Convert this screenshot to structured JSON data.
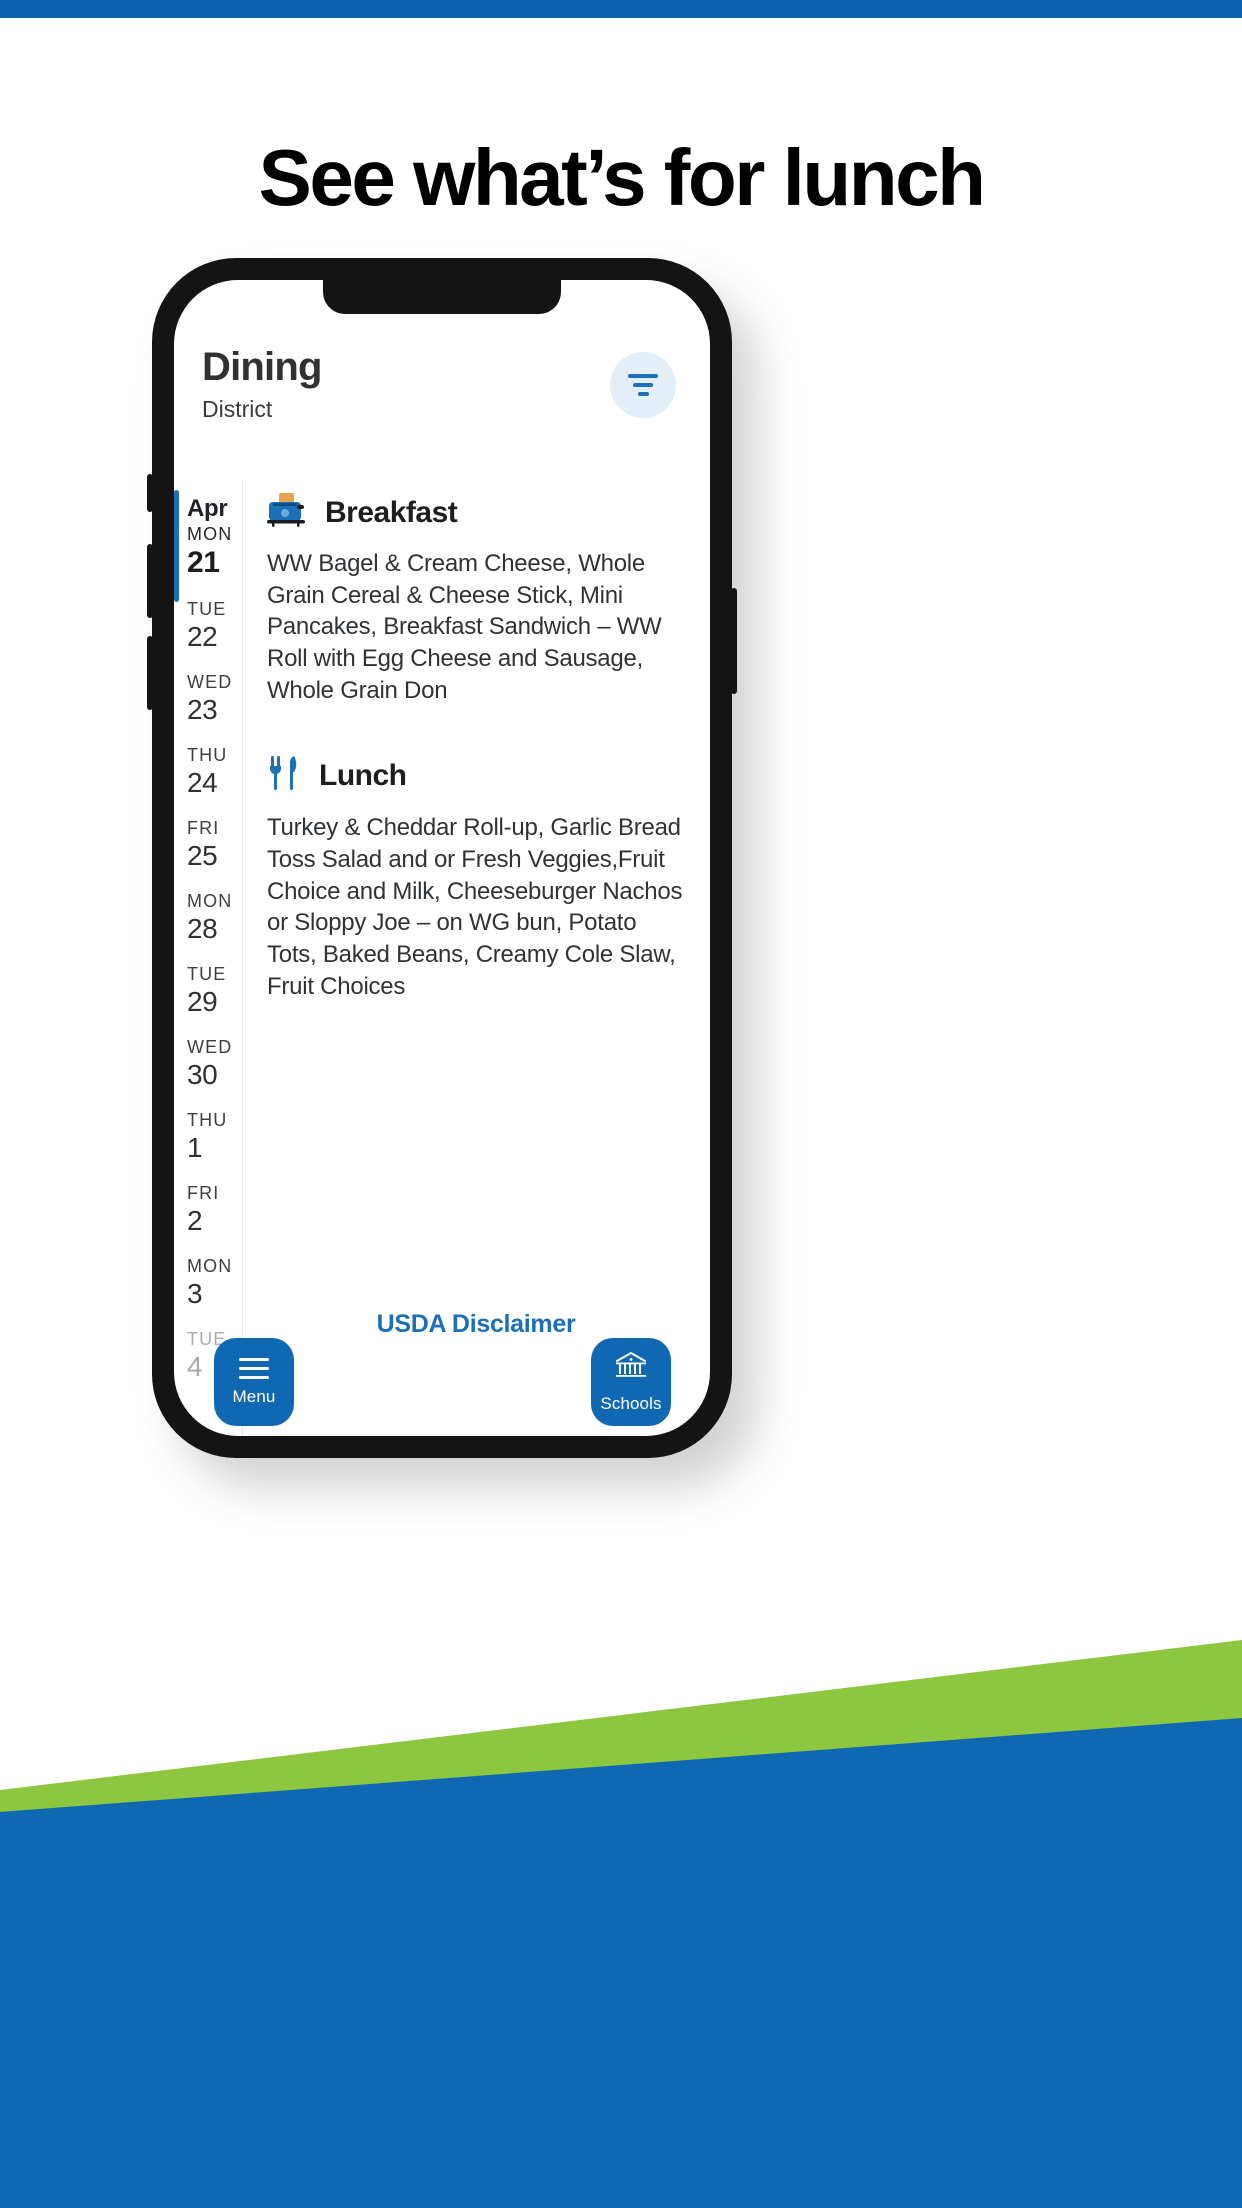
{
  "headline": "See what’s for lunch",
  "colors": {
    "brand_blue": "#0C62B0",
    "band_green": "#8DC63F",
    "band_blue": "#1068B3",
    "accent_blue": "#1B70B8",
    "filter_bg": "#E3EEF8"
  },
  "app": {
    "title": "Dining",
    "subtitle": "District",
    "filter_icon": "filter-icon"
  },
  "dates": [
    {
      "month": "Apr",
      "dow": "MON",
      "day": "21",
      "state": "active"
    },
    {
      "month": "",
      "dow": "TUE",
      "day": "22",
      "state": "normal"
    },
    {
      "month": "",
      "dow": "WED",
      "day": "23",
      "state": "normal"
    },
    {
      "month": "",
      "dow": "THU",
      "day": "24",
      "state": "normal"
    },
    {
      "month": "",
      "dow": "FRI",
      "day": "25",
      "state": "normal"
    },
    {
      "month": "",
      "dow": "MON",
      "day": "28",
      "state": "normal"
    },
    {
      "month": "",
      "dow": "TUE",
      "day": "29",
      "state": "normal"
    },
    {
      "month": "",
      "dow": "WED",
      "day": "30",
      "state": "normal"
    },
    {
      "month": "",
      "dow": "THU",
      "day": "1",
      "state": "normal"
    },
    {
      "month": "",
      "dow": "FRI",
      "day": "2",
      "state": "normal"
    },
    {
      "month": "",
      "dow": "MON",
      "day": "3",
      "state": "normal"
    },
    {
      "month": "",
      "dow": "TUE",
      "day": "4",
      "state": "dim"
    }
  ],
  "meals": {
    "breakfast": {
      "icon": "toaster-icon",
      "title": "Breakfast",
      "description": "WW Bagel & Cream Cheese, Whole Grain Cereal & Cheese Stick, Mini Pancakes, Breakfast Sandwich – WW Roll with Egg Cheese and Sausage, Whole Grain Don"
    },
    "lunch": {
      "icon": "fork-knife-icon",
      "title": "Lunch",
      "description": "Turkey & Cheddar Roll-up, Garlic Bread Toss Salad and or Fresh Veggies,Fruit Choice and Milk, Cheeseburger Nachos or Sloppy Joe – on WG bun, Potato Tots, Baked Beans, Creamy Cole Slaw, Fruit Choices"
    }
  },
  "footer": {
    "usda_link": "USDA Disclaimer",
    "menu_button": {
      "label": "Menu",
      "icon": "hamburger-icon"
    },
    "schools_button": {
      "label": "Schools",
      "icon": "school-building-icon"
    }
  }
}
